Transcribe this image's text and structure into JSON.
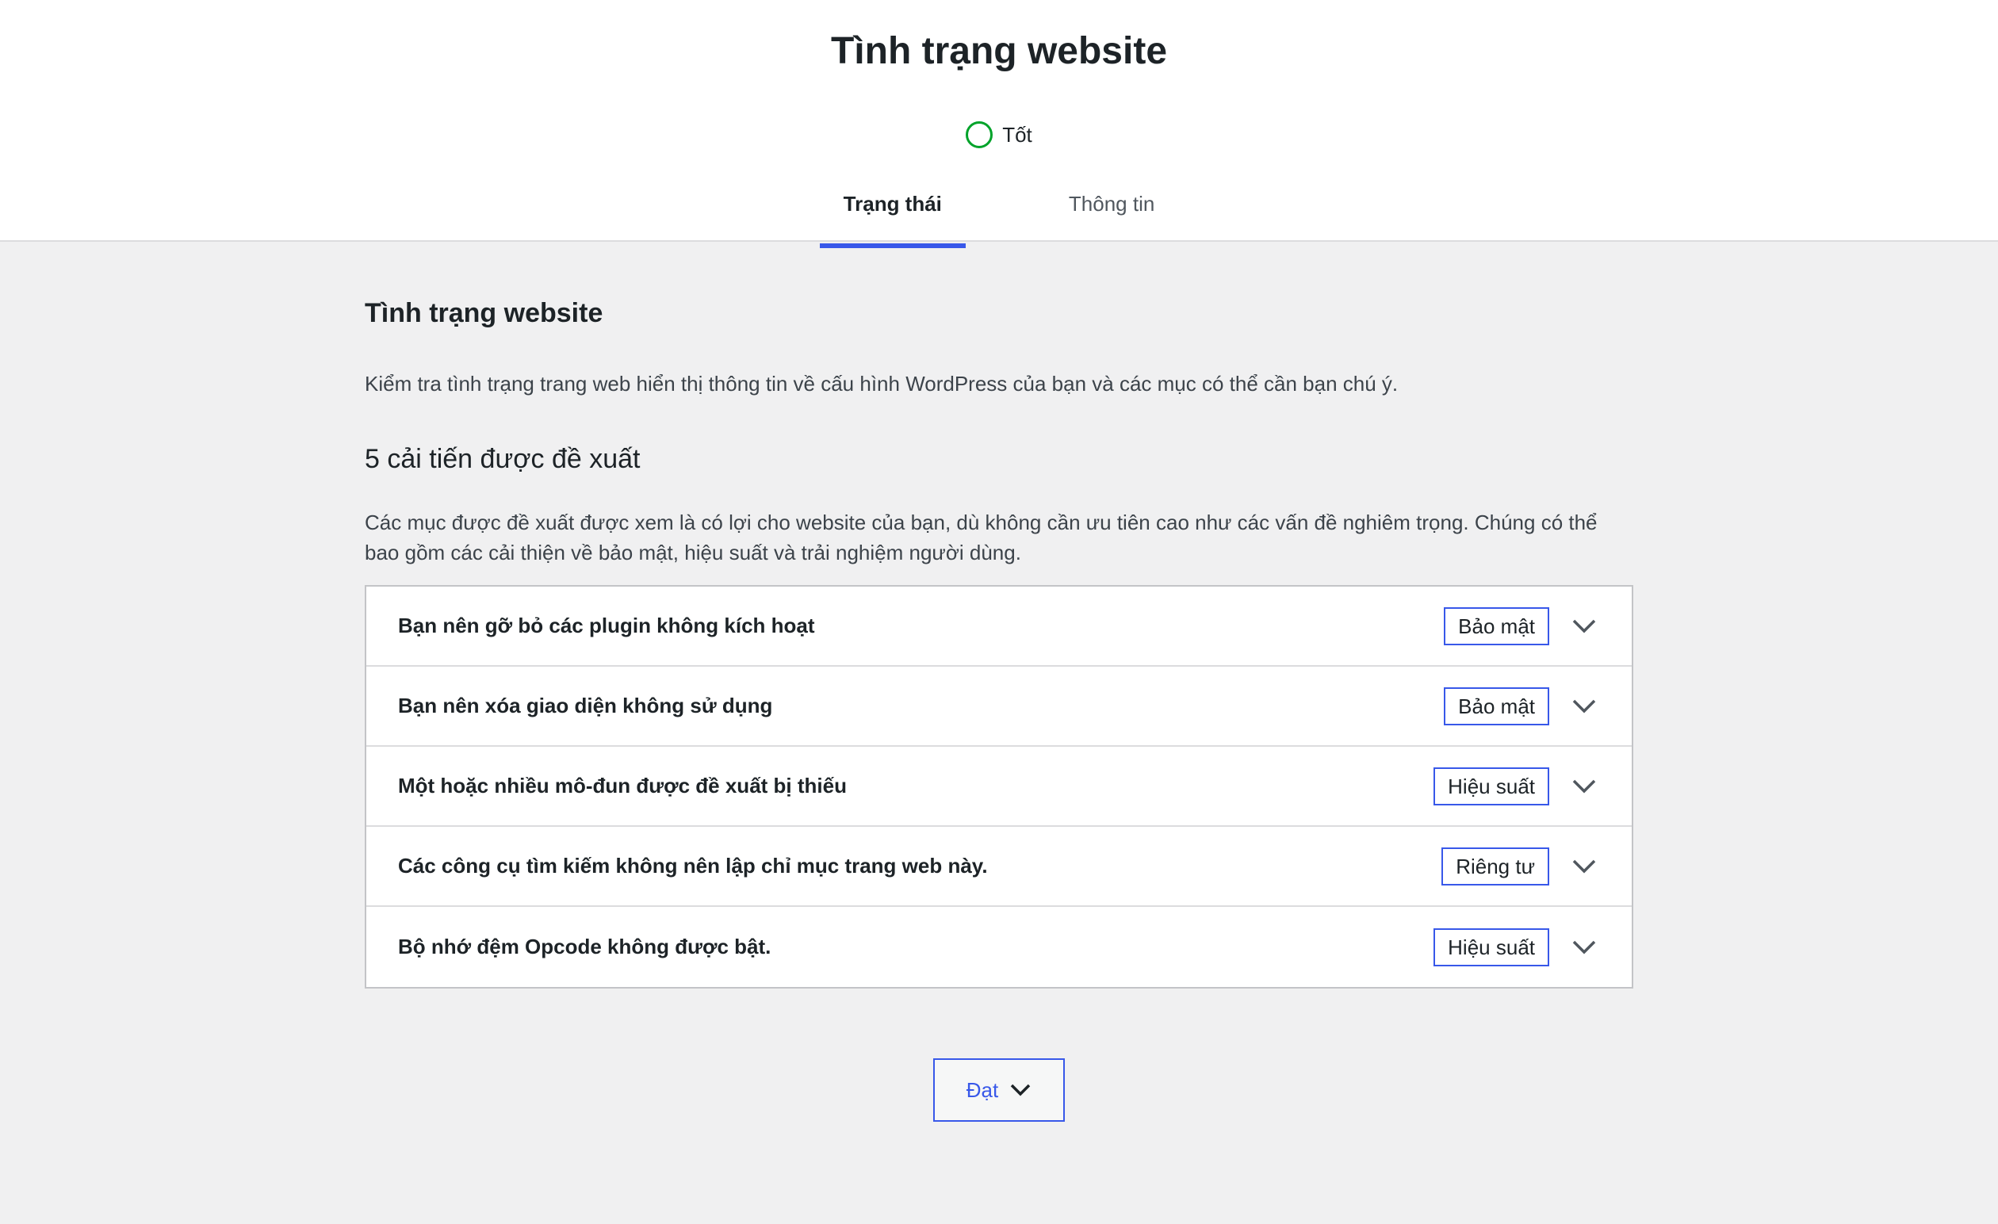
{
  "header": {
    "title": "Tình trạng website",
    "status_label": "Tốt",
    "status_color": "#00a32a",
    "tabs": [
      {
        "label": "Trạng thái",
        "active": true
      },
      {
        "label": "Thông tin",
        "active": false
      }
    ],
    "accent_color": "#3858e9"
  },
  "main": {
    "section_title": "Tình trạng website",
    "section_description": "Kiểm tra tình trạng trang web hiển thị thông tin về cấu hình WordPress của bạn và các mục có thể cần bạn chú ý.",
    "improvements_title": "5 cải tiến được đề xuất",
    "improvements_description": "Các mục được đề xuất được xem là có lợi cho website của bạn, dù không cần ưu tiên cao như các vấn đề nghiêm trọng. Chúng có thể bao gồm các cải thiện về bảo mật, hiệu suất và trải nghiệm người dùng.",
    "issues": [
      {
        "title": "Bạn nên gỡ bỏ các plugin không kích hoạt",
        "badge": "Bảo mật",
        "icon": "chevron-down-icon"
      },
      {
        "title": "Bạn nên xóa giao diện không sử dụng",
        "badge": "Bảo mật",
        "icon": "chevron-down-icon"
      },
      {
        "title": "Một hoặc nhiều mô-đun được đề xuất bị thiếu",
        "badge": "Hiệu suất",
        "icon": "chevron-down-icon"
      },
      {
        "title": "Các công cụ tìm kiếm không nên lập chỉ mục trang web này.",
        "badge": "Riêng tư",
        "icon": "chevron-down-icon"
      },
      {
        "title": "Bộ nhớ đệm Opcode không được bật.",
        "badge": "Hiệu suất",
        "icon": "chevron-down-icon"
      }
    ],
    "passed_button_label": "Đạt"
  }
}
